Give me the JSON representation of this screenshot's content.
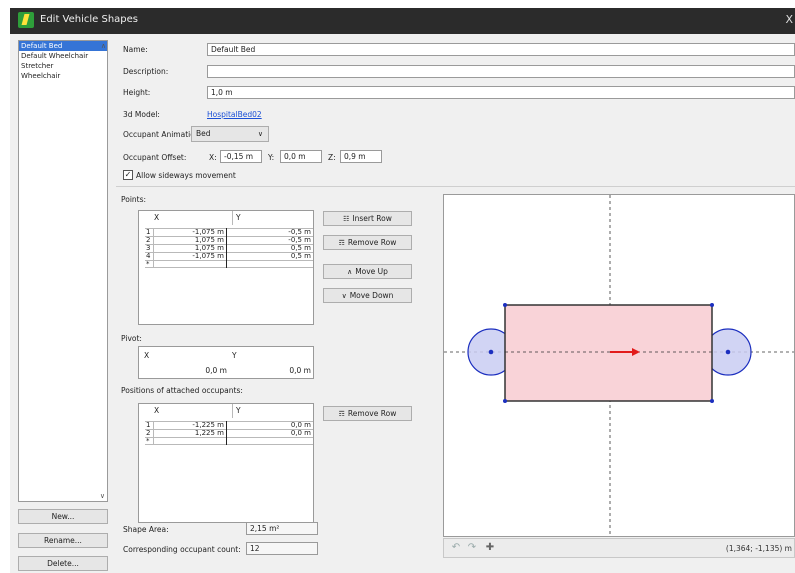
{
  "window": {
    "title": "Edit Vehicle Shapes",
    "close": "X"
  },
  "shape_list": {
    "items": [
      "Default Bed",
      "Default Wheelchair",
      "Stretcher",
      "Wheelchair"
    ],
    "selected_index": 0
  },
  "left_buttons": {
    "new": "New...",
    "rename": "Rename...",
    "delete": "Delete..."
  },
  "form": {
    "name_label": "Name:",
    "name_value": "Default Bed",
    "description_label": "Description:",
    "description_value": "",
    "height_label": "Height:",
    "height_value": "1,0 m",
    "model_label": "3d Model:",
    "model_value": "HospitalBed02",
    "animation_label": "Occupant Animation:",
    "animation_value": "Bed",
    "offset_label": "Occupant Offset:",
    "offset_x_label": "X:",
    "offset_x_value": "-0,15 m",
    "offset_y_label": "Y:",
    "offset_y_value": "0,0 m",
    "offset_z_label": "Z:",
    "offset_z_value": "0,9 m",
    "sideways_label": "Allow sideways movement",
    "sideways_checked": true
  },
  "points": {
    "label": "Points:",
    "col_x": "X",
    "col_y": "Y",
    "rows": [
      {
        "idx": "1",
        "x": "-1,075 m",
        "y": "-0,5 m"
      },
      {
        "idx": "2",
        "x": "1,075 m",
        "y": "-0,5 m"
      },
      {
        "idx": "3",
        "x": "1,075 m",
        "y": "0,5 m"
      },
      {
        "idx": "4",
        "x": "-1,075 m",
        "y": "0,5 m"
      },
      {
        "idx": "*",
        "x": "",
        "y": ""
      }
    ],
    "buttons": {
      "insert": "Insert Row",
      "remove": "Remove Row",
      "up": "Move Up",
      "down": "Move Down"
    }
  },
  "pivot": {
    "label": "Pivot:",
    "col_x": "X",
    "col_y": "Y",
    "x": "0,0 m",
    "y": "0,0 m"
  },
  "occupants": {
    "label": "Positions of attached occupants:",
    "col_x": "X",
    "col_y": "Y",
    "rows": [
      {
        "idx": "1",
        "x": "-1,225 m",
        "y": "0,0 m"
      },
      {
        "idx": "2",
        "x": "1,225 m",
        "y": "0,0 m"
      },
      {
        "idx": "*",
        "x": "",
        "y": ""
      }
    ],
    "remove": "Remove Row"
  },
  "stats": {
    "area_label": "Shape Area:",
    "area_value": "2,15 m²",
    "count_label": "Corresponding occupant count:",
    "count_value": "12"
  },
  "preview": {
    "coords": "(1,364; -1,135) m",
    "colors": {
      "shape_fill": "#f9d3d8",
      "shape_stroke": "#333333",
      "vertex": "#1c2fbf",
      "occupant_fill": "#c9ccf2",
      "arrow": "#e21b1b"
    },
    "tools": [
      "undo-icon",
      "redo-icon",
      "snap-icon"
    ]
  }
}
